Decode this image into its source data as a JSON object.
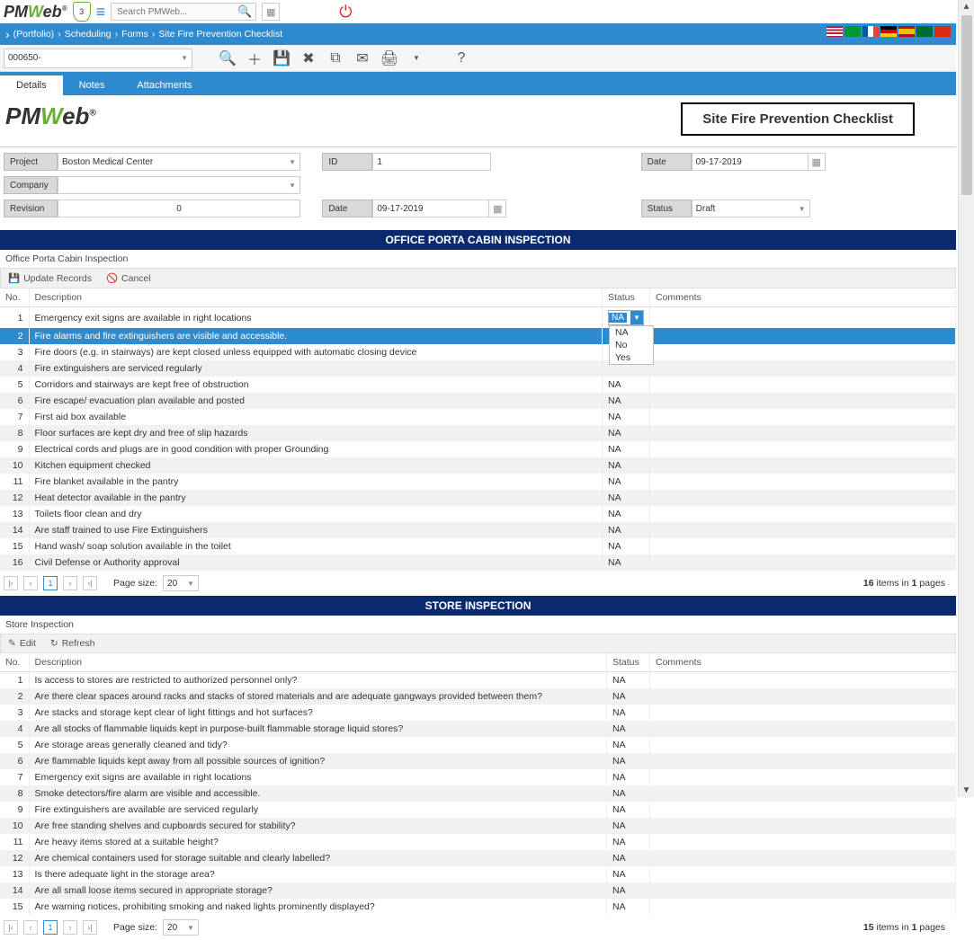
{
  "topbar": {
    "logo_pm": "PM",
    "logo_w": "W",
    "logo_eb": "eb",
    "trademark": "®",
    "shield_count": "3",
    "search_placeholder": "Search PMWeb..."
  },
  "breadcrumb": {
    "portfolio": "(Portfolio)",
    "scheduling": "Scheduling",
    "forms": "Forms",
    "page": "Site Fire Prevention Checklist"
  },
  "toolbar": {
    "doc_id": "000650-"
  },
  "tabs": {
    "details": "Details",
    "notes": "Notes",
    "attachments": "Attachments"
  },
  "header": {
    "title": "Site Fire Prevention Checklist"
  },
  "form": {
    "labels": {
      "project": "Project",
      "company": "Company",
      "revision": "Revision",
      "id": "ID",
      "date": "Date",
      "status": "Status"
    },
    "values": {
      "project": "Boston Medical Center",
      "company": "",
      "revision": "0",
      "id": "1",
      "date1": "09-17-2019",
      "date2": "09-17-2019",
      "status": "Draft"
    }
  },
  "section1": {
    "bar": "OFFICE PORTA CABIN INSPECTION",
    "subtitle": "Office Porta Cabin Inspection",
    "toolbar": {
      "update": "Update Records",
      "cancel": "Cancel"
    },
    "headers": {
      "no": "No.",
      "desc": "Description",
      "status": "Status",
      "comments": "Comments"
    },
    "active_status": "NA",
    "status_options": [
      "NA",
      "No",
      "Yes"
    ],
    "rows": [
      {
        "no": "1",
        "desc": "Emergency exit signs are available in right locations",
        "status": "NA",
        "editing": true
      },
      {
        "no": "2",
        "desc": "Fire alarms and fire extinguishers are visible and accessible.",
        "status": "",
        "selected": true
      },
      {
        "no": "3",
        "desc": "Fire doors (e.g. in stairways) are kept closed unless equipped with automatic closing device",
        "status": ""
      },
      {
        "no": "4",
        "desc": "Fire extinguishers are serviced regularly",
        "status": ""
      },
      {
        "no": "5",
        "desc": "Corridors and stairways are kept free of obstruction",
        "status": "NA"
      },
      {
        "no": "6",
        "desc": "Fire escape/ evacuation plan available and posted",
        "status": "NA"
      },
      {
        "no": "7",
        "desc": "First aid box available",
        "status": "NA"
      },
      {
        "no": "8",
        "desc": "Floor surfaces are kept dry and free of slip hazards",
        "status": "NA"
      },
      {
        "no": "9",
        "desc": "Electrical cords and plugs are in good condition with proper Grounding",
        "status": "NA"
      },
      {
        "no": "10",
        "desc": "Kitchen equipment checked",
        "status": "NA"
      },
      {
        "no": "11",
        "desc": "Fire blanket available in the pantry",
        "status": "NA"
      },
      {
        "no": "12",
        "desc": "Heat detector available in the pantry",
        "status": "NA"
      },
      {
        "no": "13",
        "desc": "Toilets floor clean and dry",
        "status": "NA"
      },
      {
        "no": "14",
        "desc": "Are staff trained to use Fire Extinguishers",
        "status": "NA"
      },
      {
        "no": "15",
        "desc": "Hand wash/ soap solution available in the toilet",
        "status": "NA"
      },
      {
        "no": "16",
        "desc": "Civil Defense or Authority approval",
        "status": "NA"
      }
    ],
    "pager": {
      "size_label": "Page size:",
      "size": "20",
      "info_count": "16",
      "info_mid": " items in ",
      "info_pages": "1",
      "info_suffix": " pages"
    }
  },
  "section2": {
    "bar": "STORE INSPECTION",
    "subtitle": "Store Inspection",
    "toolbar": {
      "edit": "Edit",
      "refresh": "Refresh"
    },
    "headers": {
      "no": "No.",
      "desc": "Description",
      "status": "Status",
      "comments": "Comments"
    },
    "rows": [
      {
        "no": "1",
        "desc": "Is access to stores are restricted to authorized personnel only?",
        "status": "NA"
      },
      {
        "no": "2",
        "desc": "Are there clear spaces around racks and stacks of stored materials and are adequate gangways provided between them?",
        "status": "NA"
      },
      {
        "no": "3",
        "desc": "Are stacks and storage kept clear of light fittings and hot surfaces?",
        "status": "NA"
      },
      {
        "no": "4",
        "desc": "Are all stocks of flammable liquids kept in purpose-built flammable storage liquid stores?",
        "status": "NA"
      },
      {
        "no": "5",
        "desc": "Are storage areas generally cleaned and tidy?",
        "status": "NA"
      },
      {
        "no": "6",
        "desc": "Are flammable liquids kept away from all possible sources of ignition?",
        "status": "NA"
      },
      {
        "no": "7",
        "desc": "Emergency exit signs are available in right locations",
        "status": "NA"
      },
      {
        "no": "8",
        "desc": "Smoke detectors/fire alarm are visible and accessible.",
        "status": "NA"
      },
      {
        "no": "9",
        "desc": "Fire extinguishers are available are serviced regularly",
        "status": "NA"
      },
      {
        "no": "10",
        "desc": "Are free standing shelves and cupboards secured for stability?",
        "status": "NA"
      },
      {
        "no": "11",
        "desc": "Are heavy items stored at a suitable height?",
        "status": "NA"
      },
      {
        "no": "12",
        "desc": "Are chemical containers used for storage suitable and clearly labelled?",
        "status": "NA"
      },
      {
        "no": "13",
        "desc": "Is there adequate light in the storage area?",
        "status": "NA"
      },
      {
        "no": "14",
        "desc": "Are all small loose items secured in appropriate storage?",
        "status": "NA"
      },
      {
        "no": "15",
        "desc": "Are warning notices, prohibiting smoking and naked lights prominently displayed?",
        "status": "NA"
      }
    ],
    "pager": {
      "size_label": "Page size:",
      "size": "20",
      "info_count": "15",
      "info_mid": " items in ",
      "info_pages": "1",
      "info_suffix": " pages"
    }
  }
}
